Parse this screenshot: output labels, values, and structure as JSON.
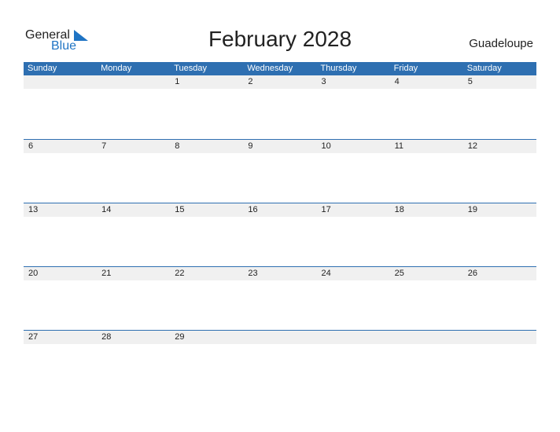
{
  "logo": {
    "general": "General",
    "blue": "Blue"
  },
  "title": "February 2028",
  "country": "Guadeloupe",
  "days": [
    "Sunday",
    "Monday",
    "Tuesday",
    "Wednesday",
    "Thursday",
    "Friday",
    "Saturday"
  ],
  "weeks": [
    [
      "",
      "",
      "1",
      "2",
      "3",
      "4",
      "5"
    ],
    [
      "6",
      "7",
      "8",
      "9",
      "10",
      "11",
      "12"
    ],
    [
      "13",
      "14",
      "15",
      "16",
      "17",
      "18",
      "19"
    ],
    [
      "20",
      "21",
      "22",
      "23",
      "24",
      "25",
      "26"
    ],
    [
      "27",
      "28",
      "29",
      "",
      "",
      "",
      ""
    ]
  ],
  "colors": {
    "accent": "#2e6fb1",
    "logo_blue": "#1f74c4",
    "row_bg": "#f0f0f0"
  }
}
